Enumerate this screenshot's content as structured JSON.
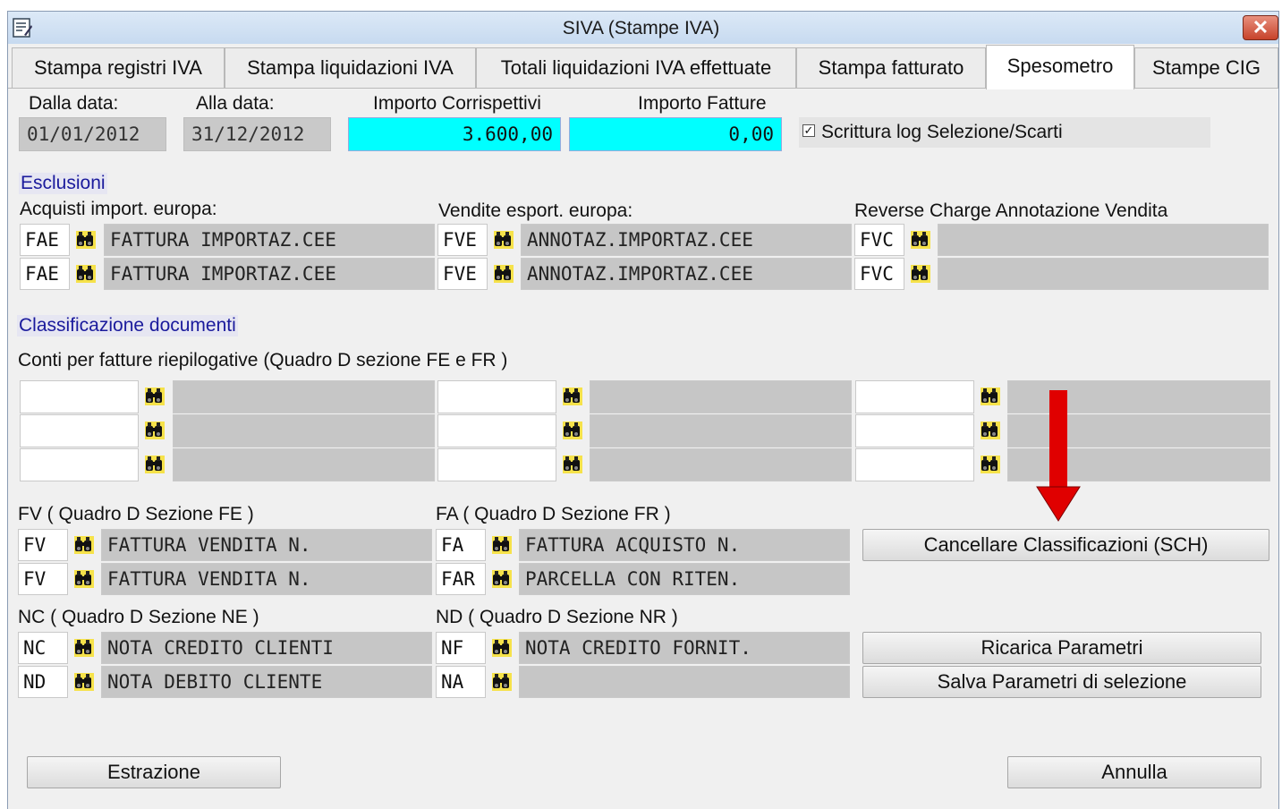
{
  "window": {
    "title": "SIVA (Stampe IVA)",
    "close_glyph": "✕"
  },
  "tabs": [
    {
      "label": "Stampa registri IVA"
    },
    {
      "label": "Stampa liquidazioni IVA"
    },
    {
      "label": "Totali liquidazioni IVA effettuate"
    },
    {
      "label": "Stampa fatturato"
    },
    {
      "label": "Spesometro"
    },
    {
      "label": "Stampe CIG"
    }
  ],
  "header": {
    "dalla_label": "Dalla data:",
    "dalla_value": "01/01/2012",
    "alla_label": "Alla data:",
    "alla_value": "31/12/2012",
    "corrisp_label": "Importo Corrispettivi",
    "corrisp_value": "3.600,00",
    "fatture_label": "Importo Fatture",
    "fatture_value": "0,00",
    "log_checkbox_label": "Scrittura log Selezione/Scarti",
    "log_checked": true
  },
  "esclusioni": {
    "title": "Esclusioni",
    "acquisti": {
      "label": "Acquisti import. europa:",
      "rows": [
        {
          "code": "FAE",
          "desc": "FATTURA IMPORTAZ.CEE"
        },
        {
          "code": "FAE",
          "desc": "FATTURA IMPORTAZ.CEE"
        }
      ]
    },
    "vendite": {
      "label": "Vendite esport. europa:",
      "rows": [
        {
          "code": "FVE",
          "desc": "ANNOTAZ.IMPORTAZ.CEE"
        },
        {
          "code": "FVE",
          "desc": "ANNOTAZ.IMPORTAZ.CEE"
        }
      ]
    },
    "reverse": {
      "label": "Reverse Charge Annotazione Vendita",
      "rows": [
        {
          "code": "FVC",
          "desc": ""
        },
        {
          "code": "FVC",
          "desc": ""
        }
      ]
    }
  },
  "classificazione": {
    "title": "Classificazione documenti",
    "conti_label": "Conti per fatture riepilogative (Quadro D sezione FE e FR )",
    "fv": {
      "label": "FV ( Quadro D Sezione FE )",
      "rows": [
        {
          "code": "FV",
          "desc": "FATTURA VENDITA N."
        },
        {
          "code": "FV",
          "desc": "FATTURA VENDITA N."
        }
      ]
    },
    "fa": {
      "label": "FA ( Quadro D Sezione FR )",
      "rows": [
        {
          "code": "FA",
          "desc": "FATTURA ACQUISTO N."
        },
        {
          "code": "FAR",
          "desc": "PARCELLA CON RITEN."
        }
      ]
    },
    "nc": {
      "label": "NC ( Quadro D Sezione NE )",
      "rows": [
        {
          "code": "NC",
          "desc": "NOTA CREDITO CLIENTI"
        },
        {
          "code": "ND",
          "desc": "NOTA DEBITO CLIENTE"
        }
      ]
    },
    "nd": {
      "label": "ND ( Quadro D Sezione NR )",
      "rows": [
        {
          "code": "NF",
          "desc": "NOTA CREDITO FORNIT."
        },
        {
          "code": "NA",
          "desc": ""
        }
      ]
    }
  },
  "buttons": {
    "cancellare": "Cancellare Classificazioni (SCH)",
    "ricarica": "Ricarica Parametri",
    "salva": "Salva Parametri di selezione",
    "estrazione": "Estrazione",
    "annulla": "Annulla"
  },
  "icons": {
    "lookup": "binoculars-icon",
    "annotation": "red-arrow-down-icon"
  },
  "colors": {
    "highlight_cyan": "#00ffff",
    "section_text": "#1a1a9c",
    "arrow": "#e00000"
  }
}
